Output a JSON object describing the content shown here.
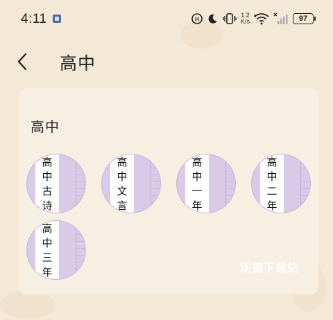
{
  "status_bar": {
    "time": "4:11",
    "net_speed_value": "1.2",
    "net_speed_unit": "K/s",
    "battery": "97"
  },
  "header": {
    "title": "高中"
  },
  "section": {
    "title": "高中",
    "books": [
      {
        "label": "高中古诗"
      },
      {
        "label": "高中文言"
      },
      {
        "label": "高中一年"
      },
      {
        "label": "高中二年"
      },
      {
        "label": "高中三年"
      }
    ]
  },
  "watermark": "沃德下载站",
  "colors": {
    "background": "#f4e8d6",
    "card": "#f8efe3",
    "book_cover": "#d9cbe8"
  }
}
